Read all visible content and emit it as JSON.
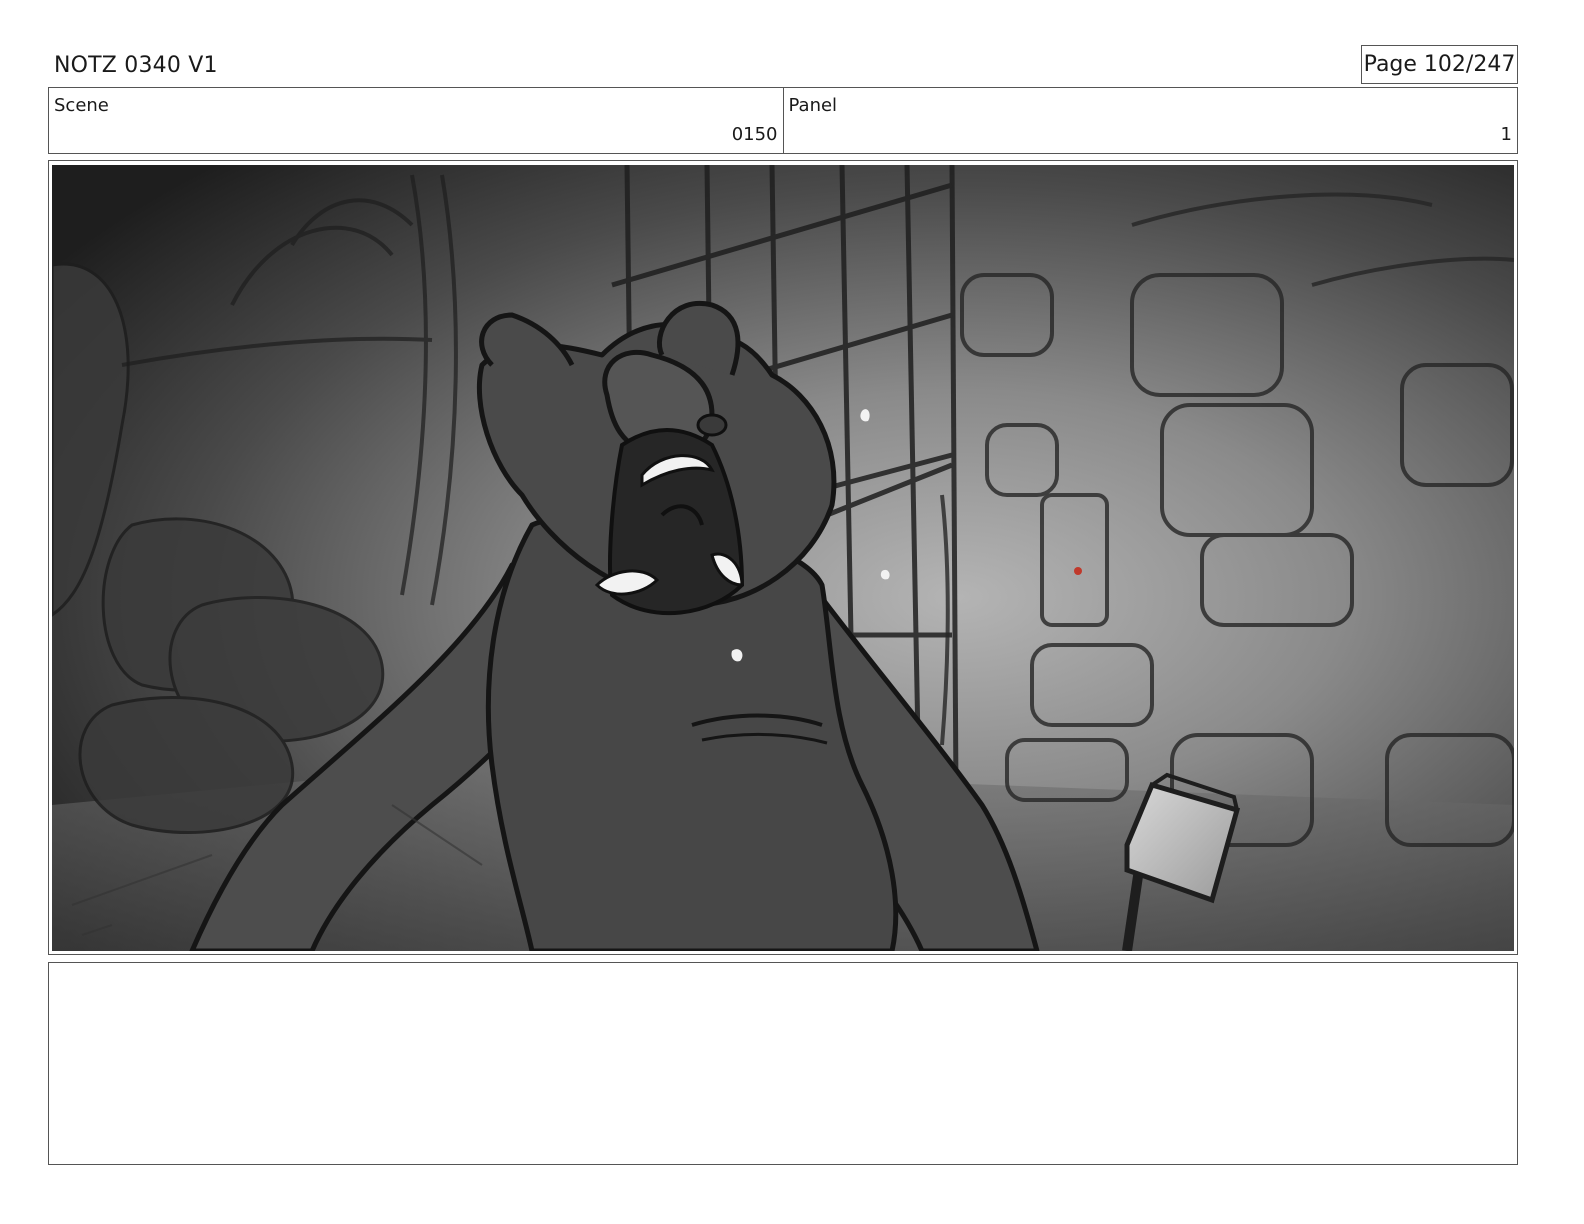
{
  "header": {
    "title": "NOTZ 0340 V1",
    "page": "Page 102/247"
  },
  "info": {
    "scene_label": "Scene",
    "scene_value": "0150",
    "panel_label": "Panel",
    "panel_value": "1"
  },
  "notes": {
    "text": ""
  },
  "colors": {
    "border": "#555555",
    "sketch_dark": "#1a1a1a",
    "highlight_red": "#c0392b"
  }
}
